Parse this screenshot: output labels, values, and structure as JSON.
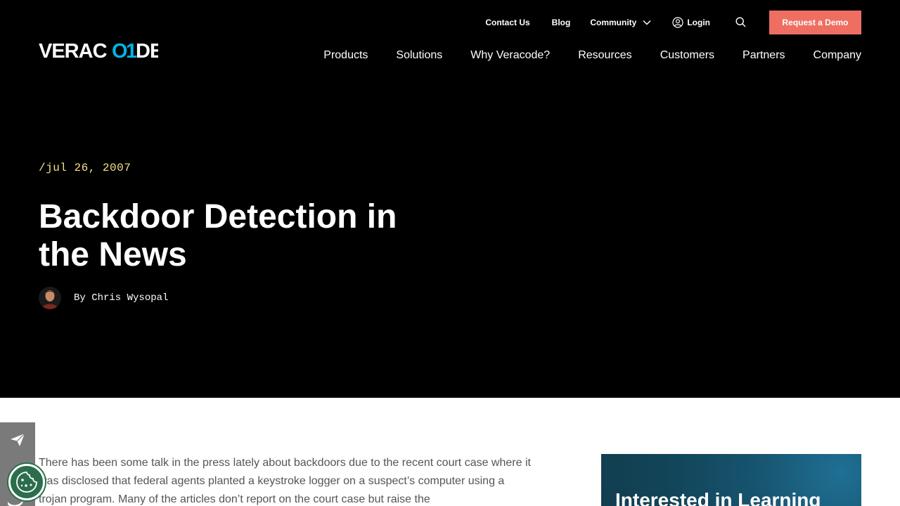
{
  "header": {
    "utility_nav": {
      "contact": "Contact Us",
      "blog": "Blog",
      "community": "Community",
      "login": "Login",
      "demo_button": "Request a Demo"
    },
    "logo_text": "VERACODE",
    "main_nav": [
      "Products",
      "Solutions",
      "Why Veracode?",
      "Resources",
      "Customers",
      "Partners",
      "Company"
    ]
  },
  "hero": {
    "date": "/jul 26, 2007",
    "title": "Backdoor Detection in the News",
    "byline": "By Chris Wysopal"
  },
  "article": {
    "intro": "There has been some talk in the press lately about backdoors due to the recent court case where it was disclosed that federal agents planted a keystroke logger on a suspect’s computer using a trojan program. Many of the articles don’t report on the court case but raise the"
  },
  "sidebar": {
    "cta_title": "Interested in Learning"
  },
  "icons": {
    "community_dropdown": "chevron-down-icon",
    "login": "user-circle-icon",
    "search": "search-icon",
    "share_send": "paper-plane-icon",
    "share_twitter": "twitter-icon",
    "cookie": "cookie-icon"
  },
  "colors": {
    "accent_button": "#ee6f62",
    "date_text": "#f7e08a",
    "logo_accent": "#00b3e6",
    "cookie_button": "#2c6e4c"
  }
}
